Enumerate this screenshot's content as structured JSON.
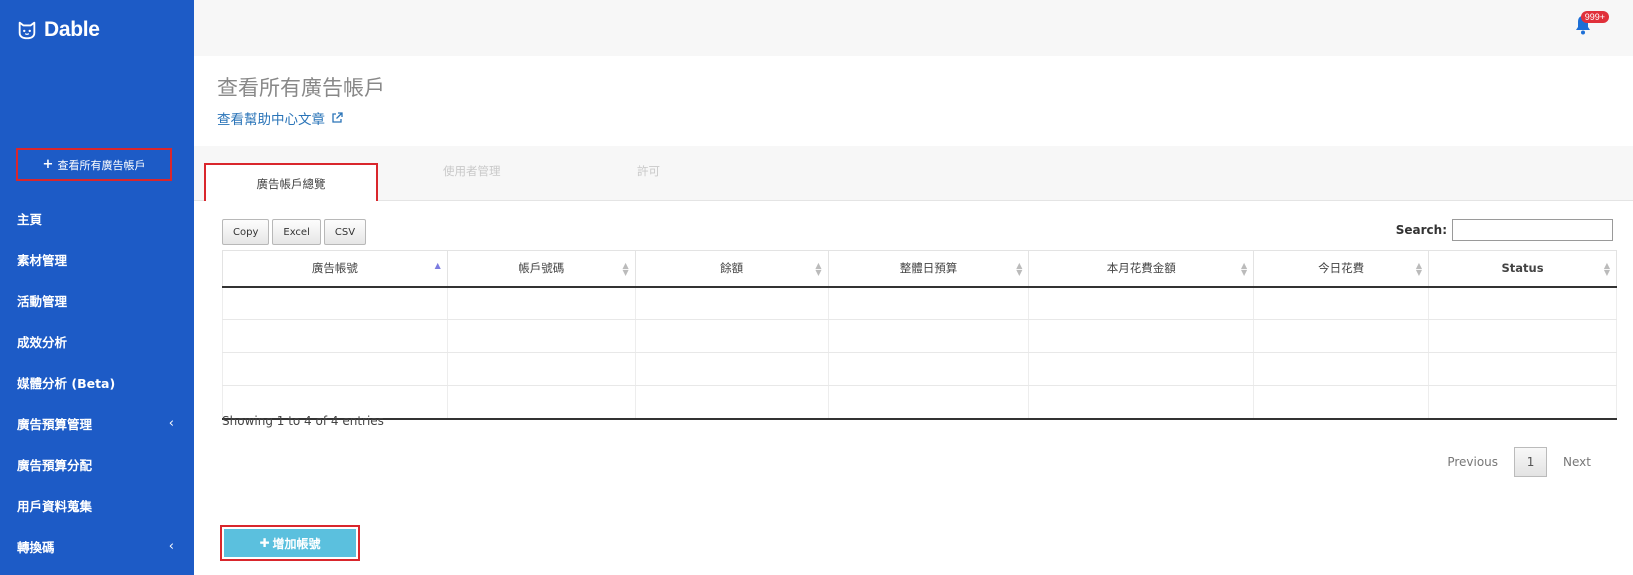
{
  "brand": {
    "name": "Dable"
  },
  "sidebar": {
    "add_account_label": "查看所有廣告帳戶",
    "items": [
      {
        "label": "主頁",
        "has_submenu": false
      },
      {
        "label": "素材管理",
        "has_submenu": false
      },
      {
        "label": "活動管理",
        "has_submenu": false
      },
      {
        "label": "成效分析",
        "has_submenu": false
      },
      {
        "label": "媒體分析 (Beta)",
        "has_submenu": false
      },
      {
        "label": "廣告預算管理",
        "has_submenu": true
      },
      {
        "label": "廣告預算分配",
        "has_submenu": false
      },
      {
        "label": "用戶資料蒐集",
        "has_submenu": false
      },
      {
        "label": "轉換碼",
        "has_submenu": true
      }
    ]
  },
  "topbar": {
    "notification_count": "999+"
  },
  "header": {
    "title": "查看所有廣告帳戶",
    "help_link": "查看幫助中心文章"
  },
  "tabs": [
    {
      "label": "廣告帳戶總覽",
      "active": true
    },
    {
      "label": "使用者管理",
      "active": false
    },
    {
      "label": "許可",
      "active": false
    }
  ],
  "toolbar": {
    "copy_label": "Copy",
    "excel_label": "Excel",
    "csv_label": "CSV",
    "search_label": "Search:",
    "search_value": ""
  },
  "table": {
    "columns": [
      "廣告帳號",
      "帳戶號碼",
      "餘額",
      "整體日預算",
      "本月花費金額",
      "今日花費",
      "Status"
    ],
    "rows": [
      [
        "",
        "",
        "",
        "",
        "",
        "",
        ""
      ],
      [
        "",
        "",
        "",
        "",
        "",
        "",
        ""
      ],
      [
        "",
        "",
        "",
        "",
        "",
        "",
        ""
      ],
      [
        "",
        "",
        "",
        "",
        "",
        "",
        ""
      ]
    ]
  },
  "info_text": "Showing 1 to 4 of 4 entries",
  "pagination": {
    "previous": "Previous",
    "current": "1",
    "next": "Next"
  },
  "add_button_label": "增加帳號",
  "colors": {
    "sidebar_bg": "#1d5bc6",
    "highlight_border": "#d9262c",
    "add_button": "#5bc0de",
    "link": "#2a74b8",
    "badge": "#e0303a"
  }
}
